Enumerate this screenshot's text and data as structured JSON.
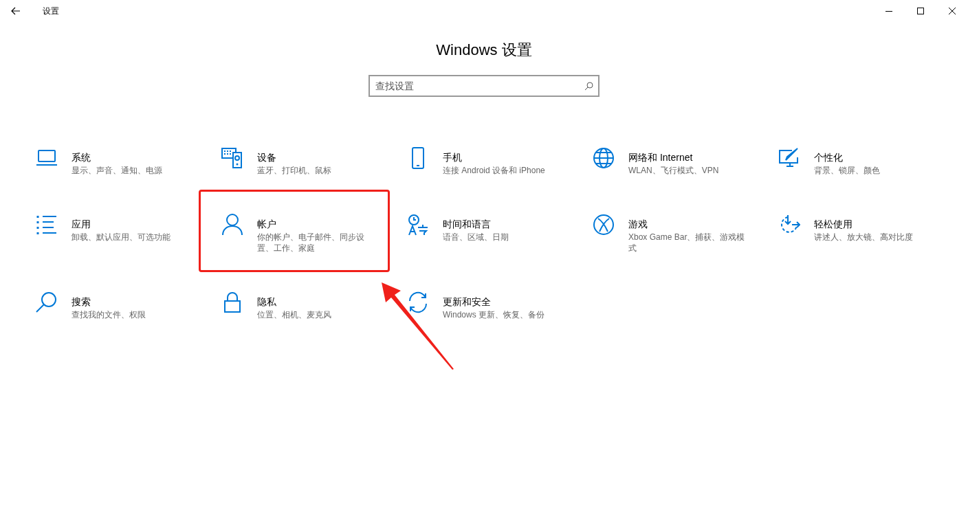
{
  "window": {
    "title": "设置"
  },
  "heading": "Windows 设置",
  "search": {
    "placeholder": "查找设置"
  },
  "items": [
    {
      "title": "系统",
      "description": "显示、声音、通知、电源",
      "highlighted": false
    },
    {
      "title": "设备",
      "description": "蓝牙、打印机、鼠标",
      "highlighted": false
    },
    {
      "title": "手机",
      "description": "连接 Android 设备和 iPhone",
      "highlighted": false
    },
    {
      "title": "网络和 Internet",
      "description": "WLAN、飞行模式、VPN",
      "highlighted": false
    },
    {
      "title": "个性化",
      "description": "背景、锁屏、颜色",
      "highlighted": false
    },
    {
      "title": "应用",
      "description": "卸载、默认应用、可选功能",
      "highlighted": false
    },
    {
      "title": "帐户",
      "description": "你的帐户、电子邮件、同步设置、工作、家庭",
      "highlighted": true
    },
    {
      "title": "时间和语言",
      "description": "语音、区域、日期",
      "highlighted": false
    },
    {
      "title": "游戏",
      "description": "Xbox Game Bar、捕获、游戏模式",
      "highlighted": false
    },
    {
      "title": "轻松使用",
      "description": "讲述人、放大镜、高对比度",
      "highlighted": false
    },
    {
      "title": "搜索",
      "description": "查找我的文件、权限",
      "highlighted": false
    },
    {
      "title": "隐私",
      "description": "位置、相机、麦克风",
      "highlighted": false
    },
    {
      "title": "更新和安全",
      "description": "Windows 更新、恢复、备份",
      "highlighted": false
    }
  ]
}
